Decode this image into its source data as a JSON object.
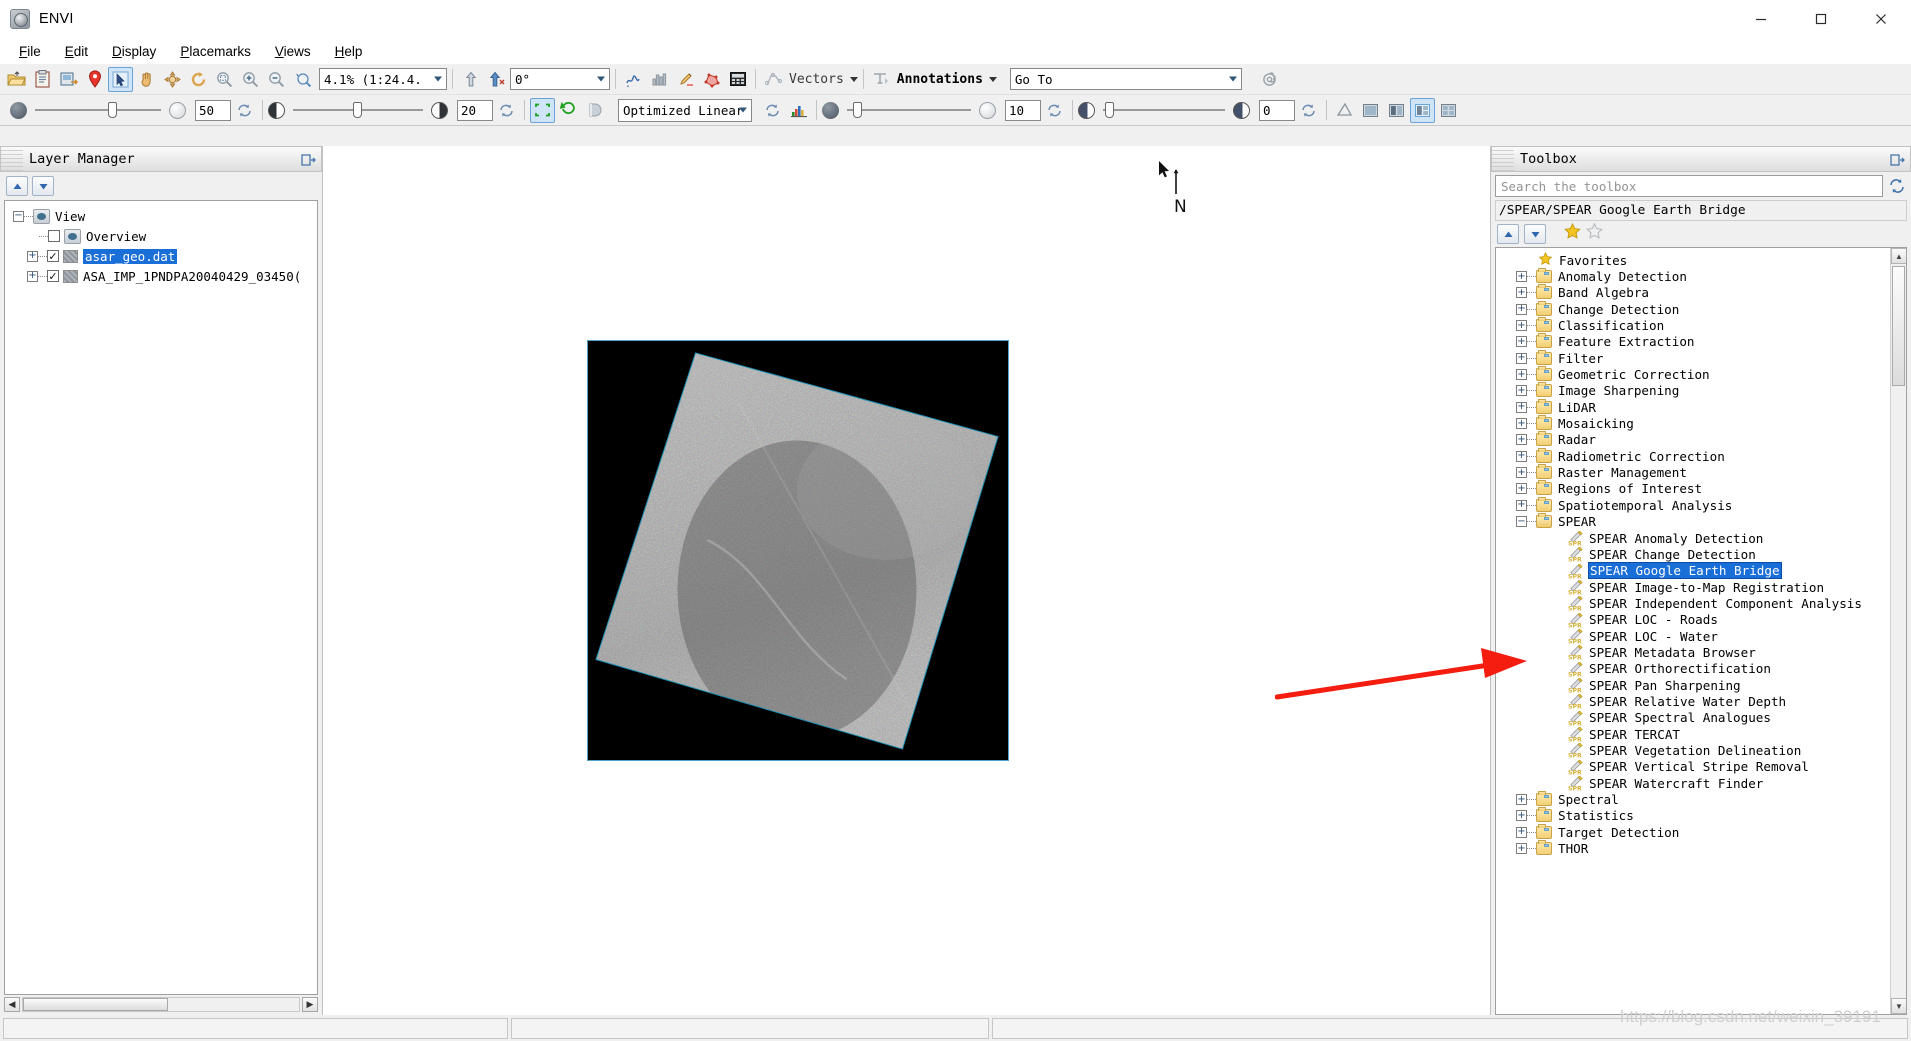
{
  "window": {
    "title": "ENVI",
    "app_icon": "envi-globe-icon",
    "minimize": "—",
    "maximize": "☐",
    "close": "✕"
  },
  "menubar": [
    {
      "label": "File",
      "mnemonic": "F"
    },
    {
      "label": "Edit",
      "mnemonic": "E"
    },
    {
      "label": "Display",
      "mnemonic": "D"
    },
    {
      "label": "Placemarks",
      "mnemonic": "P"
    },
    {
      "label": "Views",
      "mnemonic": "V"
    },
    {
      "label": "Help",
      "mnemonic": "H"
    }
  ],
  "toolbar_main": {
    "icons": [
      "open-folder-icon",
      "paste-clipboard-icon",
      "save-image-icon",
      "placemark-pin-icon",
      "select-arrow-icon",
      "pan-hand-icon",
      "fly-crosshair-icon",
      "rotate-icon",
      "zoom-fit-icon",
      "zoom-in-icon",
      "zoom-out-icon",
      "zoom-custom-icon"
    ],
    "zoom_value": "4.1% (1:24.4.",
    "icons_after_zoom": [
      "up-arrow-icon",
      "north-arrow-icon"
    ],
    "rotation_value": "0°",
    "icons2": [
      "spectral-profile-icon",
      "histogram-icon",
      "pencil-roi-icon",
      "roi-tool-icon",
      "calculator-icon"
    ],
    "vectors_label": "Vectors",
    "annotations_label": "Annotations",
    "goto_placeholder": "Go To",
    "goto_value": "",
    "settings_icon": "gear-icon"
  },
  "toolbar_display": {
    "brightness_value": "50",
    "brightness_icon_left": "brightness-dark-icon",
    "brightness_icon_right": "brightness-light-icon",
    "brightness_reset": "reset-icon",
    "contrast_value": "20",
    "contrast_icon_left": "contrast-icon",
    "contrast_icon_right": "contrast-high-icon",
    "contrast_reset": "reset-icon",
    "portal_icons": [
      "portal-fixed-icon",
      "portal-flicker-icon",
      "blend-icon"
    ],
    "stretch_value": "Optimized Linear",
    "stretch_reset": "reset-icon",
    "histogram_icon": "color-histogram-icon",
    "sharpen_value": "10",
    "sharpen_reset": "reset-icon",
    "transparency_value": "0",
    "transparency_reset": "reset-icon",
    "right_icons": [
      "measure-icon",
      "view-single-icon",
      "view-two-icon",
      "view-three-icon",
      "view-four-icon"
    ]
  },
  "layer_manager": {
    "title": "Layer Manager",
    "pin_icon": "pin-panel-icon",
    "move_up": "chevron-up-icon",
    "move_down": "chevron-down-icon",
    "tree": [
      {
        "label": "View",
        "level": 0,
        "expander": "−",
        "icon": "view-eye-icon",
        "checkbox": null,
        "selected": false
      },
      {
        "label": "Overview",
        "level": 1,
        "expander": null,
        "icon": "view-eye-icon",
        "checkbox": false,
        "selected": false
      },
      {
        "label": "asar_geo.dat",
        "level": 1,
        "expander": "+",
        "icon": "raster-layer-icon",
        "checkbox": true,
        "selected": true
      },
      {
        "label": "ASA_IMP_1PNDPA20040429_03450(",
        "level": 1,
        "expander": "+",
        "icon": "raster-layer-icon",
        "checkbox": true,
        "selected": false
      }
    ],
    "hscroll_left": "◀",
    "hscroll_right": "▶"
  },
  "view": {
    "north_label": "N",
    "cursor_icon": "pointer-cursor-icon",
    "image_name": "asar-sar-scene"
  },
  "toolbox": {
    "title": "Toolbox",
    "pin_icon": "pin-panel-icon",
    "search_placeholder": "Search the toolbox",
    "search_value": "",
    "refresh_icon": "refresh-icon",
    "breadcrumb": "/SPEAR/SPEAR Google Earth Bridge",
    "collapse_up": "chevron-up-icon",
    "collapse_down": "chevron-down-icon",
    "favorite_on_icon": "star-filled-icon",
    "favorite_off_icon": "star-outline-icon",
    "tree": [
      {
        "label": "Favorites",
        "type": "favorites",
        "expander": null,
        "indent": 1
      },
      {
        "label": "Anomaly Detection",
        "type": "folder",
        "expander": "+",
        "indent": 1
      },
      {
        "label": "Band Algebra",
        "type": "folder",
        "expander": "+",
        "indent": 1
      },
      {
        "label": "Change Detection",
        "type": "folder",
        "expander": "+",
        "indent": 1
      },
      {
        "label": "Classification",
        "type": "folder",
        "expander": "+",
        "indent": 1
      },
      {
        "label": "Feature Extraction",
        "type": "folder",
        "expander": "+",
        "indent": 1
      },
      {
        "label": "Filter",
        "type": "folder",
        "expander": "+",
        "indent": 1
      },
      {
        "label": "Geometric Correction",
        "type": "folder",
        "expander": "+",
        "indent": 1
      },
      {
        "label": "Image Sharpening",
        "type": "folder",
        "expander": "+",
        "indent": 1
      },
      {
        "label": "LiDAR",
        "type": "folder",
        "expander": "+",
        "indent": 1
      },
      {
        "label": "Mosaicking",
        "type": "folder",
        "expander": "+",
        "indent": 1
      },
      {
        "label": "Radar",
        "type": "folder",
        "expander": "+",
        "indent": 1
      },
      {
        "label": "Radiometric Correction",
        "type": "folder",
        "expander": "+",
        "indent": 1
      },
      {
        "label": "Raster Management",
        "type": "folder",
        "expander": "+",
        "indent": 1
      },
      {
        "label": "Regions of Interest",
        "type": "folder",
        "expander": "+",
        "indent": 1
      },
      {
        "label": "Spatiotemporal Analysis",
        "type": "folder",
        "expander": "+",
        "indent": 1
      },
      {
        "label": "SPEAR",
        "type": "folder-open",
        "expander": "−",
        "indent": 1
      },
      {
        "label": "SPEAR Anomaly Detection",
        "type": "task",
        "expander": null,
        "indent": 2
      },
      {
        "label": "SPEAR Change Detection",
        "type": "task",
        "expander": null,
        "indent": 2
      },
      {
        "label": "SPEAR Google Earth Bridge",
        "type": "task",
        "expander": null,
        "indent": 2,
        "selected": true
      },
      {
        "label": "SPEAR Image-to-Map Registration",
        "type": "task",
        "expander": null,
        "indent": 2
      },
      {
        "label": "SPEAR Independent Component Analysis",
        "type": "task",
        "expander": null,
        "indent": 2
      },
      {
        "label": "SPEAR LOC - Roads",
        "type": "task",
        "expander": null,
        "indent": 2
      },
      {
        "label": "SPEAR LOC - Water",
        "type": "task",
        "expander": null,
        "indent": 2
      },
      {
        "label": "SPEAR Metadata Browser",
        "type": "task",
        "expander": null,
        "indent": 2
      },
      {
        "label": "SPEAR Orthorectification",
        "type": "task",
        "expander": null,
        "indent": 2
      },
      {
        "label": "SPEAR Pan Sharpening",
        "type": "task",
        "expander": null,
        "indent": 2
      },
      {
        "label": "SPEAR Relative Water Depth",
        "type": "task",
        "expander": null,
        "indent": 2
      },
      {
        "label": "SPEAR Spectral Analogues",
        "type": "task",
        "expander": null,
        "indent": 2
      },
      {
        "label": "SPEAR TERCAT",
        "type": "task",
        "expander": null,
        "indent": 2
      },
      {
        "label": "SPEAR Vegetation Delineation",
        "type": "task",
        "expander": null,
        "indent": 2
      },
      {
        "label": "SPEAR Vertical Stripe Removal",
        "type": "task",
        "expander": null,
        "indent": 2
      },
      {
        "label": "SPEAR Watercraft Finder",
        "type": "task",
        "expander": null,
        "indent": 2
      },
      {
        "label": "Spectral",
        "type": "folder",
        "expander": "+",
        "indent": 1
      },
      {
        "label": "Statistics",
        "type": "folder",
        "expander": "+",
        "indent": 1
      },
      {
        "label": "Target Detection",
        "type": "folder",
        "expander": "+",
        "indent": 1
      },
      {
        "label": "THOR",
        "type": "folder",
        "expander": "+",
        "indent": 1
      }
    ]
  },
  "annotation": {
    "arrow_name": "red-pointer-arrow",
    "arrow_color": "#f41d10",
    "points_to": "SPEAR Google Earth Bridge"
  },
  "statusbar": {
    "cells": [
      "",
      "",
      ""
    ],
    "watermark": "https://blog.csdn.net/weixin_39191"
  },
  "colors": {
    "selection_blue": "#1a6ed8",
    "panel_grey": "#f0f0f0",
    "image_border": "#4ea3c8",
    "accent_red": "#f41d10"
  }
}
